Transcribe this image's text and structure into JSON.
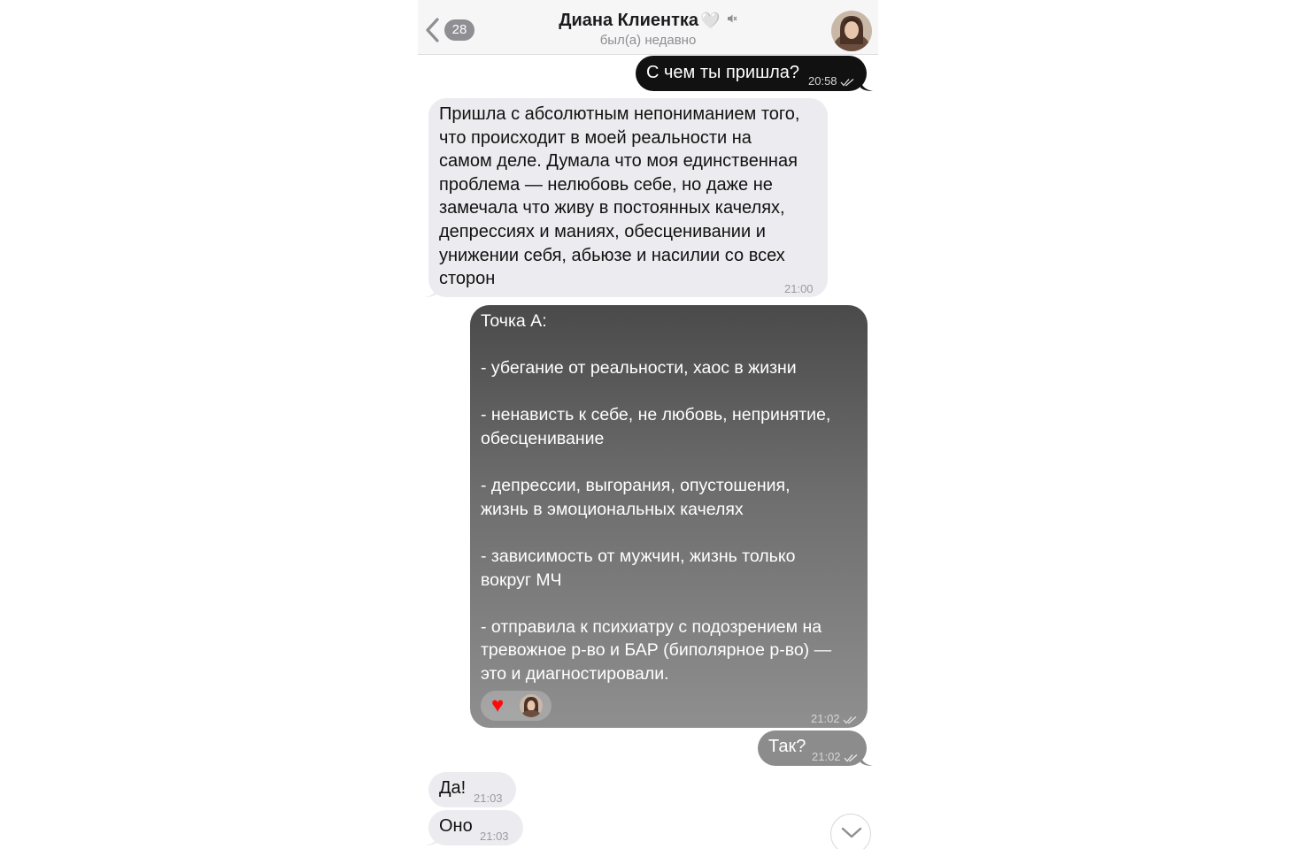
{
  "header": {
    "back_count": "28",
    "contact_name": "Диана Клиентка",
    "heart_glyph": "🤍",
    "mute_glyph": "🔇",
    "status": "был(а) недавно"
  },
  "messages": {
    "m1": {
      "text": "С чем ты пришла?",
      "time": "20:58"
    },
    "m2": {
      "text": "Пришла с абсолютным непониманием того,\nчто происходит в моей реальности на\nсамом деле. Думала что моя единственная\nпроблема — нелюбовь себе, но даже не\nзамечала что живу в постоянных качелях,\nдепрессиях и маниях, обесценивании и\nунижении себя, абьюзе и насилии со всех\nсторон",
      "time": "21:00"
    },
    "m3": {
      "title": "Точка А:",
      "items": [
        "- убегание от реальности, хаос в жизни",
        "- ненависть к себе, не любовь, непринятие,\nобесценивание",
        "- депрессии, выгорания, опустошения,\nжизнь в эмоциональных качелях",
        "- зависимость от мужчин, жизнь только\nвокруг МЧ",
        "- отправила к психиатру с подозрением на\nтревожное р-во и БАР (биполярное р-во) —\nэто и диагностировали."
      ],
      "reaction": "♥",
      "time": "21:02"
    },
    "m4": {
      "text": "Так?",
      "time": "21:02"
    },
    "m5": {
      "text": "Да!",
      "time": "21:03"
    },
    "m6": {
      "text": "Оно",
      "time": "21:03"
    }
  },
  "icons": {
    "back": "chevron-left-icon",
    "ticks": "double-check-icon",
    "scroll": "chevron-down-icon"
  }
}
